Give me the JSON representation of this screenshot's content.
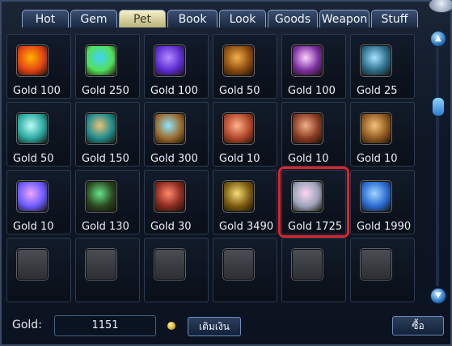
{
  "tabs": [
    {
      "label": "Hot",
      "active": false
    },
    {
      "label": "Gem",
      "active": false
    },
    {
      "label": "Pet",
      "active": true
    },
    {
      "label": "Book",
      "active": false
    },
    {
      "label": "Look",
      "active": false
    },
    {
      "label": "Goods",
      "active": false
    },
    {
      "label": "Weapon",
      "active": false
    },
    {
      "label": "Stuff",
      "active": false
    }
  ],
  "items": [
    {
      "price": "Gold 100",
      "icon": "fire-crystal-icon",
      "colors": [
        "#ffb400",
        "#e14314"
      ]
    },
    {
      "price": "Gold 250",
      "icon": "rainbow-crystal-icon",
      "colors": [
        "#3fd2ff",
        "#53e05a"
      ]
    },
    {
      "price": "Gold 100",
      "icon": "purple-crystal-icon",
      "colors": [
        "#b58cff",
        "#5b2bd1"
      ]
    },
    {
      "price": "Gold 50",
      "icon": "orange-potion-icon",
      "colors": [
        "#f3b24a",
        "#8a4a10"
      ]
    },
    {
      "price": "Gold 100",
      "icon": "violet-potion-icon",
      "colors": [
        "#ffd1ff",
        "#7b2e9f"
      ]
    },
    {
      "price": "Gold 25",
      "icon": "treasure-chest-icon",
      "colors": [
        "#a8e3ff",
        "#2b6c8a"
      ]
    },
    {
      "price": "Gold 50",
      "icon": "cyan-potion-icon",
      "colors": [
        "#b9fff7",
        "#2aa8a0"
      ]
    },
    {
      "price": "Gold 150",
      "icon": "teal-bottle-icon",
      "colors": [
        "#e7c37b",
        "#1f8a8c"
      ]
    },
    {
      "price": "Gold 300",
      "icon": "gold-bottle-icon",
      "colors": [
        "#8ee6ff",
        "#9a6a2b"
      ]
    },
    {
      "price": "Gold 10",
      "icon": "shell-icon",
      "colors": [
        "#ffb38a",
        "#b1462a"
      ]
    },
    {
      "price": "Gold 10",
      "icon": "meat-icon",
      "colors": [
        "#f0b08a",
        "#8a3a22"
      ]
    },
    {
      "price": "Gold 10",
      "icon": "mushroom-icon",
      "colors": [
        "#f6c27a",
        "#8f5a21"
      ]
    },
    {
      "price": "Gold 10",
      "icon": "pink-flask-icon",
      "colors": [
        "#f2a6ff",
        "#6a5bff"
      ]
    },
    {
      "price": "Gold 130",
      "icon": "green-scroll-icon",
      "colors": [
        "#68e38a",
        "#2a4a20"
      ]
    },
    {
      "price": "Gold 30",
      "icon": "red-mushroom-icon",
      "colors": [
        "#ff8a6a",
        "#8a2a20"
      ]
    },
    {
      "price": "Gold 3490",
      "icon": "golden-emblem-icon",
      "colors": [
        "#f6de7a",
        "#7a5a10"
      ]
    },
    {
      "price": "Gold 1725",
      "icon": "cage-icon",
      "colors": [
        "#ffd6f2",
        "#9aa2b8"
      ],
      "highlighted": true
    },
    {
      "price": "Gold 1990",
      "icon": "blue-map-icon",
      "colors": [
        "#9fd6ff",
        "#2b6ad1"
      ]
    },
    {
      "price": "",
      "icon": "empty-slot-icon",
      "empty": true
    },
    {
      "price": "",
      "icon": "empty-slot-icon",
      "empty": true
    },
    {
      "price": "",
      "icon": "empty-slot-icon",
      "empty": true
    },
    {
      "price": "",
      "icon": "empty-slot-icon",
      "empty": true
    },
    {
      "price": "",
      "icon": "empty-slot-icon",
      "empty": true
    },
    {
      "price": "",
      "icon": "empty-slot-icon",
      "empty": true
    }
  ],
  "footer": {
    "gold_label": "Gold:",
    "gold_value": "1151",
    "topup_label": "เติมเงิน",
    "buy_label": "ซื้อ"
  },
  "accent": "#d9262a"
}
